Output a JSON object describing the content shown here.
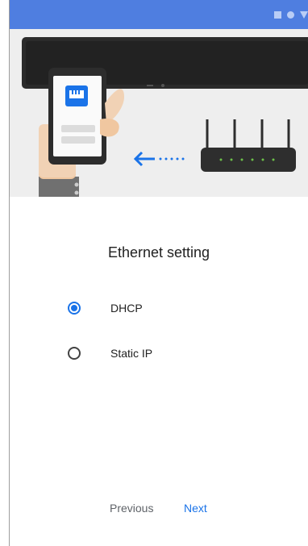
{
  "status_bar": {
    "icons": [
      "square-icon",
      "circle-icon",
      "triangle-icon"
    ],
    "color": "#4f7ee0"
  },
  "illustration": {
    "icons": [
      "phone-with-ethernet-icon",
      "router-icon",
      "arrow-left-icon",
      "hand-icon",
      "tv-bar-icon"
    ],
    "accent": "#1a73e8",
    "background": "#eeeeee"
  },
  "page": {
    "title": "Ethernet setting"
  },
  "options": [
    {
      "label": "DHCP",
      "checked": true
    },
    {
      "label": "Static IP",
      "checked": false
    }
  ],
  "buttons": {
    "previous": "Previous",
    "next": "Next"
  }
}
